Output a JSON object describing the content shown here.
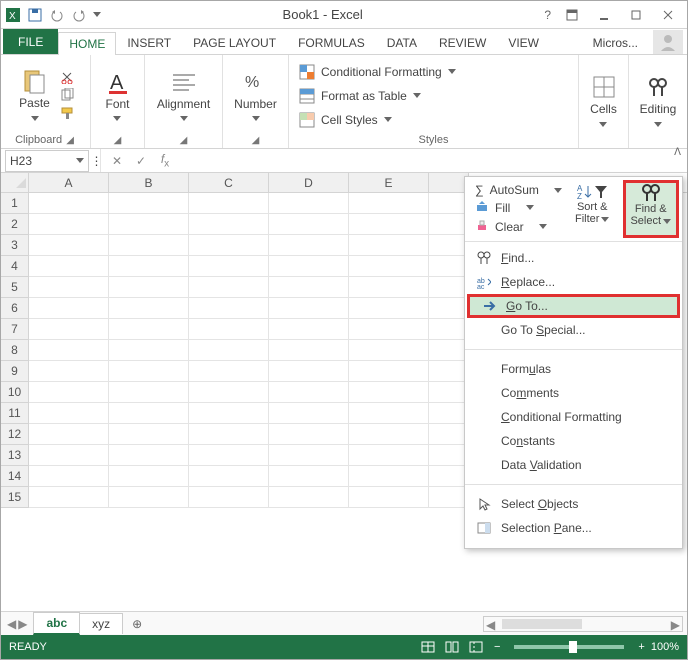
{
  "title": "Book1 - Excel",
  "tabs": {
    "file": "FILE",
    "home": "HOME",
    "insert": "INSERT",
    "pagelayout": "PAGE LAYOUT",
    "formulas": "FORMULAS",
    "data": "DATA",
    "review": "REVIEW",
    "view": "VIEW",
    "account": "Micros..."
  },
  "groups": {
    "clipboard": {
      "paste": "Paste",
      "label": "Clipboard"
    },
    "font": {
      "btn": "Font",
      "label": ""
    },
    "alignment": {
      "btn": "Alignment",
      "label": ""
    },
    "number": {
      "btn": "Number",
      "label": ""
    },
    "styles": {
      "cond": "Conditional Formatting",
      "fat": "Format as Table",
      "cell": "Cell Styles",
      "label": "Styles"
    },
    "cells": {
      "btn": "Cells"
    },
    "editing": {
      "btn": "Editing"
    }
  },
  "namebox": "H23",
  "columns": [
    "A",
    "B",
    "C",
    "D",
    "E"
  ],
  "rowcount": 15,
  "sheets": {
    "s1": "abc",
    "s2": "xyz"
  },
  "status": {
    "ready": "READY",
    "zoom": "100%"
  },
  "editing_menu": {
    "autosum": "AutoSum",
    "fill": "Fill",
    "clear": "Clear",
    "sortfilter": "Sort & Filter",
    "findselect": "Find & Select",
    "find": "Find...",
    "replace": "Replace...",
    "goto": "Go To...",
    "gotospecial": "Go To Special...",
    "formulas": "Formulas",
    "comments": "Comments",
    "cf": "Conditional Formatting",
    "constants": "Constants",
    "dv": "Data Validation",
    "selobj": "Select Objects",
    "selpane": "Selection Pane..."
  }
}
